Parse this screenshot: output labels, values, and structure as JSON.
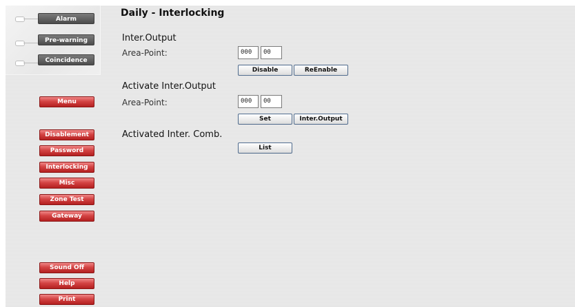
{
  "status": {
    "alarm_label": "Alarm",
    "prewarning_label": "Pre-warning",
    "coincidence_label": "Coincidence"
  },
  "nav": {
    "menu_label": "Menu",
    "items": [
      "Disablement",
      "Password",
      "Interlocking",
      "Misc",
      "Zone Test",
      "Gateway"
    ],
    "sound_off_label": "Sound Off",
    "help_label": "Help",
    "print_label": "Print"
  },
  "page_title": "Daily - Interlocking",
  "inter_output": {
    "heading": "Inter.Output",
    "area_point_label": "Area-Point:",
    "area_value": "000",
    "point_value": "00",
    "disable_label": "Disable",
    "reenable_label": "ReEnable"
  },
  "activate": {
    "heading": "Activate Inter.Output",
    "area_point_label": "Area-Point:",
    "area_value": "000",
    "point_value": "00",
    "set_label": "Set",
    "inter_output_label": "Inter.Output"
  },
  "activated": {
    "heading": "Activated Inter. Comb.",
    "list_label": "List"
  }
}
